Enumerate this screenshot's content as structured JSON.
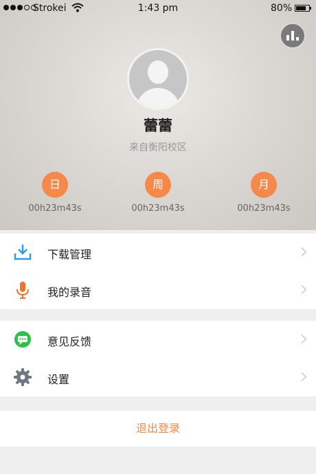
{
  "status_bar": {
    "carrier": "Strokei",
    "time": "1:43 pm",
    "battery": "80%"
  },
  "profile": {
    "name": "蕾蕾",
    "campus": "来自衡阳校区"
  },
  "stats": [
    {
      "label": "日",
      "value": "00h23m43s"
    },
    {
      "label": "周",
      "value": "00h23m43s"
    },
    {
      "label": "月",
      "value": "00h23m43s"
    }
  ],
  "menu": {
    "group1": [
      {
        "label": "下载管理",
        "icon": "download-icon"
      },
      {
        "label": "我的录音",
        "icon": "microphone-icon"
      }
    ],
    "group2": [
      {
        "label": "意见反馈",
        "icon": "chat-bubble-icon"
      },
      {
        "label": "设置",
        "icon": "gear-icon"
      }
    ]
  },
  "logout_label": "退出登录",
  "colors": {
    "accent": "#f6894a",
    "download": "#2a9be4",
    "microphone": "#f07329",
    "feedback": "#2bc04a",
    "settings": "#6f7782"
  }
}
